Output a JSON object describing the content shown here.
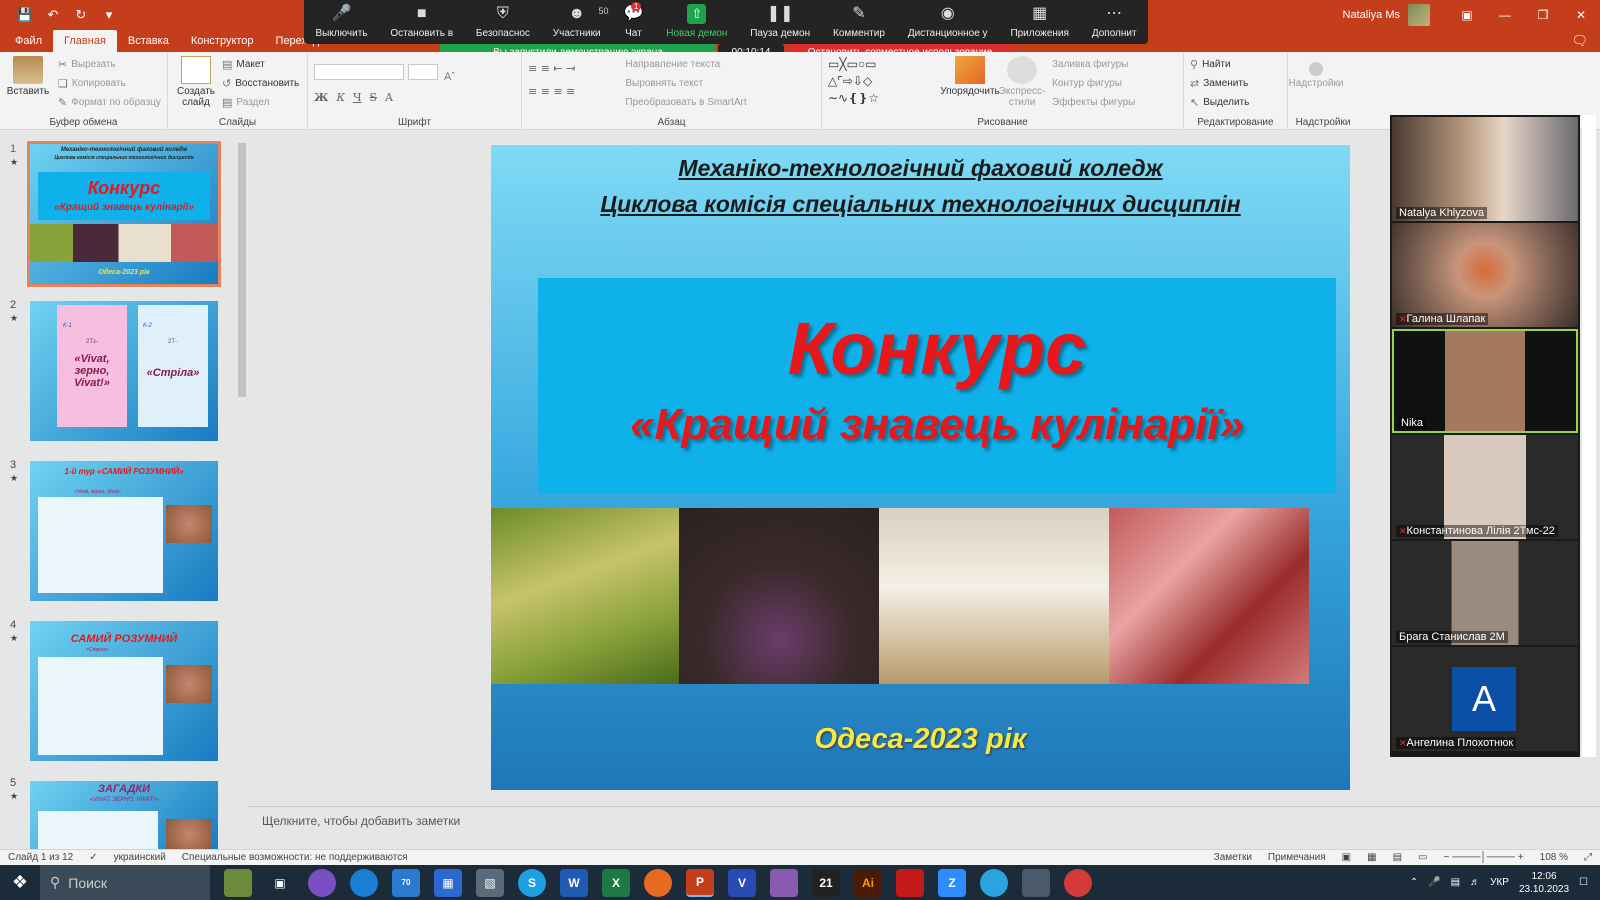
{
  "titlebar": {
    "user_name": "Nataliya Ms",
    "qat_icons": [
      "save-icon",
      "undo-icon",
      "redo-icon",
      "customize-icon"
    ]
  },
  "zoom": {
    "items": [
      {
        "label": "Выключить",
        "icon": "microphone-icon"
      },
      {
        "label": "Остановить в",
        "icon": "camera-icon"
      },
      {
        "label": "Безопаснос",
        "icon": "shield-icon"
      },
      {
        "label": "Участники",
        "icon": "participants-icon",
        "count": "50"
      },
      {
        "label": "Чат",
        "icon": "chat-icon",
        "badge": "1"
      },
      {
        "label": "Новая демон",
        "icon": "share-screen-icon"
      },
      {
        "label": "Пауза демон",
        "icon": "pause-icon"
      },
      {
        "label": "Комментир",
        "icon": "annotate-icon"
      },
      {
        "label": "Дистанционное у",
        "icon": "remote-control-icon"
      },
      {
        "label": "Приложения",
        "icon": "apps-icon"
      },
      {
        "label": "Дополнит",
        "icon": "more-icon"
      }
    ],
    "share_banner": "Вы запустили демонстрацию экрана",
    "timer": "00:10:14",
    "stop_share": "Остановить совместное использование"
  },
  "tabs": [
    "Файл",
    "Главная",
    "Вставка",
    "Конструктор",
    "Переходы"
  ],
  "ribbon": {
    "clipboard": {
      "label": "Буфер обмена",
      "paste": "Вставить",
      "cut": "Вырезать",
      "copy": "Копировать",
      "format_painter": "Формат по образцу"
    },
    "slides": {
      "label": "Слайды",
      "new_slide_1": "Создать",
      "new_slide_2": "слайд",
      "layout": "Макет",
      "reset": "Восстановить",
      "section": "Раздел"
    },
    "font": {
      "label": "Шрифт"
    },
    "paragraph": {
      "label": "Абзац",
      "text_direction": "Направление текста",
      "align_text": "Выровнять текст",
      "smartart": "Преобразовать в SmartArt"
    },
    "drawing": {
      "label": "Рисование",
      "arrange": "Упорядочить",
      "quick_styles_1": "Экспресс-",
      "quick_styles_2": "стили",
      "shape_fill": "Заливка фигуры",
      "shape_outline": "Контур фигуры",
      "shape_effects": "Эффекты фигуры"
    },
    "editing": {
      "label": "Редактирование",
      "find": "Найти",
      "replace": "Заменить",
      "select": "Выделить"
    },
    "addins": {
      "label": "Надстройки",
      "btn": "Надстройки"
    }
  },
  "thumbnails": {
    "t1": {
      "num": "1",
      "l1": "Механіко-технологічний фаховий коледж",
      "l2": "Циклова комісія спеціальних технологічних дисциплін",
      "title": "Конкурс",
      "sub": "«Кращий знавець кулінарії»",
      "foot": "Одеса-2023 рік"
    },
    "t2": {
      "num": "2",
      "k1": "К-1",
      "k1n": "2Тз-",
      "k1t": "«Vivat, зерно, Vivat!»",
      "k2": "К-2",
      "k2n": "2Т-",
      "k2t": "«Стріла»"
    },
    "t3": {
      "num": "3",
      "title": "1-й тур «САМИЙ РОЗУМНИЙ»",
      "sub": "«Vivat, зерно, Vivat»"
    },
    "t4": {
      "num": "4",
      "title": "САМИЙ РОЗУМНИЙ",
      "sub": "«Стріла»"
    },
    "t5": {
      "num": "5",
      "title": "ЗАГАДКИ",
      "sub": "«VIVAT, ЗЕРНО, VIVAT!»"
    }
  },
  "slide": {
    "header1": "Механіко-технологічний фаховий коледж",
    "header2": "Циклова комісія спеціальних технологічних дисциплін",
    "title": "Конкурс",
    "subtitle": "«Кращий знавець кулінарії»",
    "footer": "Одеса-2023 рік"
  },
  "notes_placeholder": "Щелкните, чтобы добавить заметки",
  "participants": [
    {
      "name": "Natalya Khlyzova",
      "muted": false
    },
    {
      "name": "Галина Шлапак",
      "muted": true
    },
    {
      "name": "Nika",
      "muted": false,
      "active": true
    },
    {
      "name": "Константинова Лілія 2Тмс-22",
      "muted": true
    },
    {
      "name": "Брага Станислав 2М",
      "muted": false
    },
    {
      "name": "Ангелина  Плохотнюк",
      "muted": true,
      "initial": "A"
    }
  ],
  "status": {
    "slide_info": "Слайд 1 из 12",
    "language": "украинский",
    "accessibility": "Специальные возможности: не поддерживаются",
    "notes": "Заметки",
    "comments": "Примечания",
    "zoom": "108 %"
  },
  "taskbar": {
    "search": "Поиск",
    "mail_badge": "70",
    "calendar_day": "21",
    "lang": "УКР",
    "time": "12:06",
    "date": "23.10.2023"
  },
  "colors": {
    "accent": "#c43e1c",
    "share_green": "#1fa34a",
    "stop_red": "#e02d2d"
  }
}
